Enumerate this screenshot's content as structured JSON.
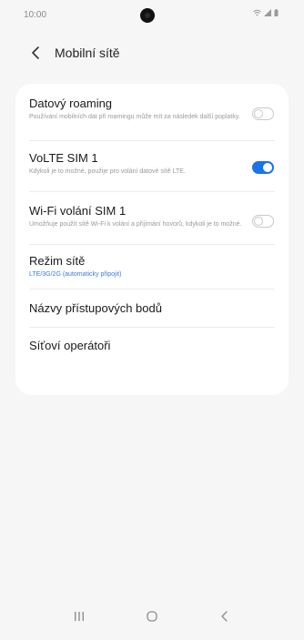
{
  "status_bar": {
    "time": "10:00"
  },
  "header": {
    "title": "Mobilní sítě"
  },
  "settings": [
    {
      "title": "Datový roaming",
      "subtitle": "Používání mobilních dat při roamingu může mít za následek další poplatky.",
      "toggle": "off"
    },
    {
      "title": "VoLTE SIM 1",
      "subtitle": "Kdykoli je to možné, použije pro volání datové sítě LTE.",
      "toggle": "on"
    },
    {
      "title": "Wi-Fi volání SIM 1",
      "subtitle": "Umožňuje použít sítě Wi-Fi k volání a přijímání hovorů, kdykoli je to možné.",
      "toggle": "off"
    },
    {
      "title": "Režim sítě",
      "subtitle": "LTE/3G/2G (automaticky připojit)"
    },
    {
      "title": "Názvy přístupových bodů"
    },
    {
      "title": "Síťoví operátoři"
    }
  ],
  "colors": {
    "accent": "#1a73e8",
    "link": "#3d7ad6",
    "background": "#f6f6f6"
  },
  "icons": {
    "back": "chevron-left-icon",
    "recents": "recents-icon",
    "home": "home-icon",
    "nav_back": "back-icon"
  }
}
